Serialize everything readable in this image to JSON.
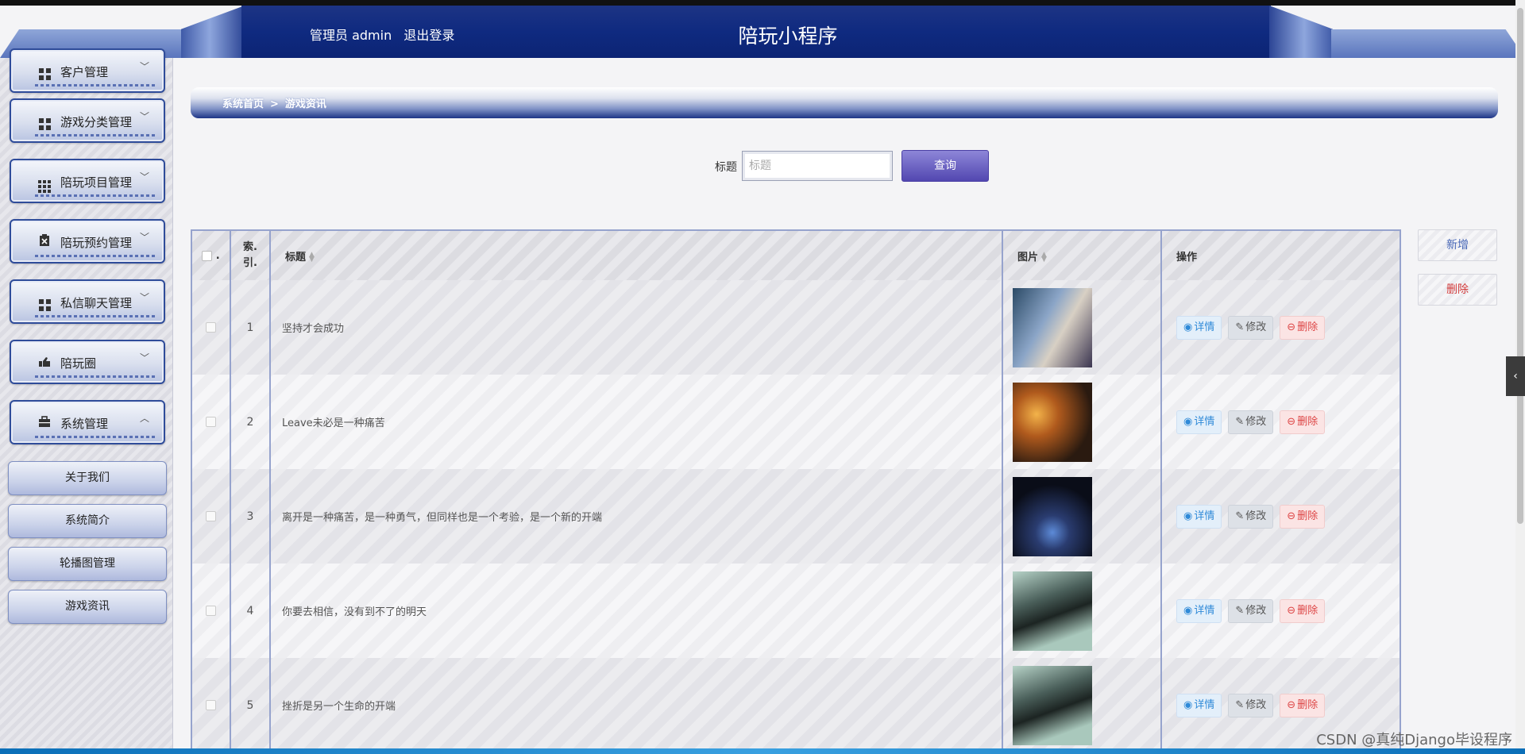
{
  "header": {
    "user_text": "管理员 admin",
    "logout": "退出登录",
    "title": "陪玩小程序"
  },
  "sidebar": {
    "menus": [
      {
        "label": "客户管理",
        "icon": "grid-icon"
      },
      {
        "label": "游戏分类管理",
        "icon": "grid-icon"
      },
      {
        "label": "陪玩项目管理",
        "icon": "apps-icon"
      },
      {
        "label": "陪玩预约管理",
        "icon": "clipboard-icon"
      },
      {
        "label": "私信聊天管理",
        "icon": "grid-icon"
      },
      {
        "label": "陪玩圈",
        "icon": "hand-icon"
      },
      {
        "label": "系统管理",
        "icon": "briefcase-icon"
      }
    ],
    "submenus": [
      "关于我们",
      "系统简介",
      "轮播图管理",
      "游戏资讯"
    ]
  },
  "breadcrumb": {
    "home": "系统首页",
    "separator": ">",
    "current": "游戏资讯"
  },
  "search": {
    "label": "标题",
    "placeholder": "标题",
    "button": "查询"
  },
  "actions": {
    "add": "新增",
    "delete": "删除"
  },
  "table": {
    "headers": {
      "index_line1": "索.",
      "index_line2": "引.",
      "title": "标题",
      "image": "图片",
      "ops": "操作"
    },
    "op_labels": {
      "detail": "详情",
      "edit": "修改",
      "delete": "删除"
    },
    "rows": [
      {
        "index": "1",
        "title": "坚持才会成功",
        "image": "thumb-1"
      },
      {
        "index": "2",
        "title": "Leave未必是一种痛苦",
        "image": "thumb-2"
      },
      {
        "index": "3",
        "title": "离开是一种痛苦，是一种勇气，但同样也是一个考验，是一个新的开端",
        "image": "thumb-3"
      },
      {
        "index": "4",
        "title": "你要去相信，没有到不了的明天",
        "image": "thumb-4"
      },
      {
        "index": "5",
        "title": "挫折是另一个生命的开端",
        "image": "thumb-4"
      }
    ]
  },
  "watermark": "CSDN @真纯Django毕设程序"
}
